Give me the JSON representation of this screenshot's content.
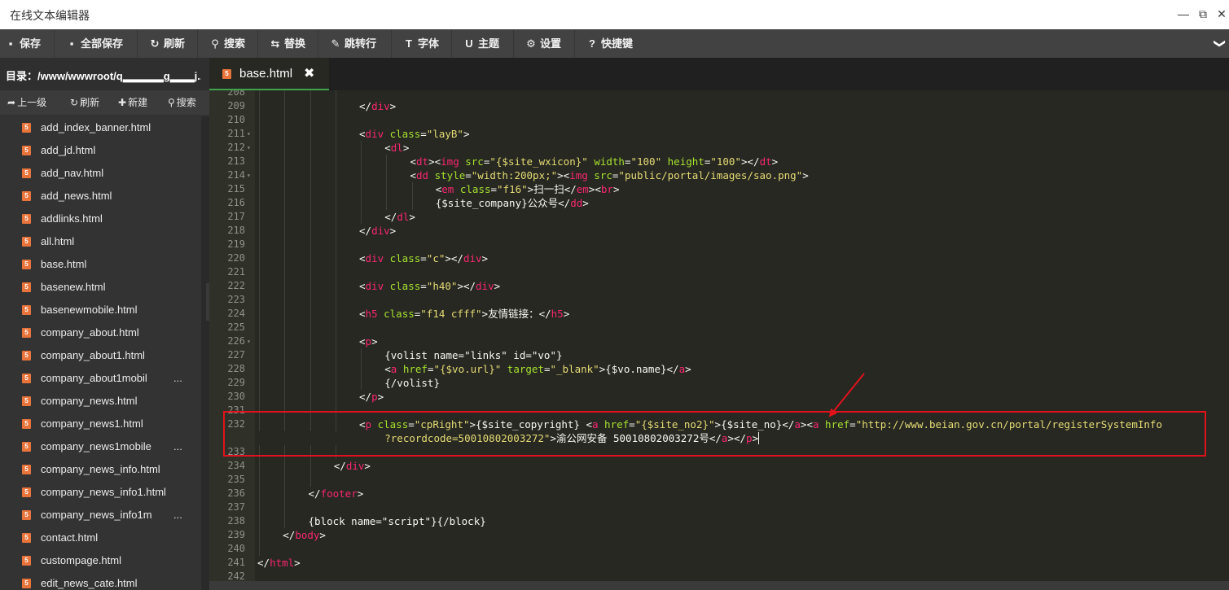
{
  "window": {
    "title": "在线文本编辑器",
    "controls": [
      "—",
      "⧉",
      "✕"
    ]
  },
  "toolbar": [
    {
      "label": "保存",
      "icon": "save-icon",
      "glyph": "▪"
    },
    {
      "label": "全部保存",
      "icon": "save-all-icon",
      "glyph": "▪"
    },
    {
      "label": "刷新",
      "icon": "refresh-icon",
      "glyph": "↻"
    },
    {
      "label": "搜索",
      "icon": "search-icon",
      "glyph": "⚲"
    },
    {
      "label": "替换",
      "icon": "replace-icon",
      "glyph": "⇆"
    },
    {
      "label": "跳转行",
      "icon": "pin-icon",
      "glyph": "✎"
    },
    {
      "label": "字体",
      "icon": "font-icon",
      "glyph": "T"
    },
    {
      "label": "主题",
      "icon": "theme-icon",
      "glyph": "U"
    },
    {
      "label": "设置",
      "icon": "gear-icon",
      "glyph": "⚙"
    },
    {
      "label": "快捷键",
      "icon": "help-icon",
      "glyph": "?"
    }
  ],
  "toolbar_more": "❯",
  "sidebar": {
    "directory": "目录：/www/wwwroot/q▂▂▂▂▂g▂▂▂j...",
    "tools": [
      {
        "label": "上一级",
        "icon": "up-level-icon",
        "glyph": "➦"
      },
      {
        "label": "刷新",
        "icon": "refresh-icon",
        "glyph": "↻"
      },
      {
        "label": "新建",
        "icon": "plus-icon",
        "glyph": "✚"
      },
      {
        "label": "搜索",
        "icon": "search-icon",
        "glyph": "⚲"
      }
    ],
    "files": [
      {
        "name": "add_index_banner.html"
      },
      {
        "name": "add_jd.html"
      },
      {
        "name": "add_nav.html"
      },
      {
        "name": "add_news.html"
      },
      {
        "name": "addlinks.html"
      },
      {
        "name": "all.html"
      },
      {
        "name": "base.html"
      },
      {
        "name": "basenew.html"
      },
      {
        "name": "basenewmobile.html"
      },
      {
        "name": "company_about.html"
      },
      {
        "name": "company_about1.html"
      },
      {
        "name": "company_about1mobil",
        "more": "..."
      },
      {
        "name": "company_news.html"
      },
      {
        "name": "company_news1.html"
      },
      {
        "name": "company_news1mobile",
        "more": "..."
      },
      {
        "name": "company_news_info.html"
      },
      {
        "name": "company_news_info1.html"
      },
      {
        "name": "company_news_info1m",
        "more": "..."
      },
      {
        "name": "contact.html"
      },
      {
        "name": "custompage.html"
      },
      {
        "name": "edit_news_cate.html"
      }
    ],
    "file_icon": "5"
  },
  "tab": {
    "label": "base.html",
    "close": "✖",
    "icon": "5"
  },
  "editor": {
    "lines": [
      {
        "n": "208",
        "indent": 4,
        "fold": false,
        "tokens": []
      },
      {
        "n": "209",
        "indent": 4,
        "fold": false,
        "tokens": [
          {
            "t": "</",
            "c": "tx"
          },
          {
            "t": "div",
            "c": "tg"
          },
          {
            "t": ">",
            "c": "tx"
          }
        ]
      },
      {
        "n": "210",
        "indent": 4,
        "fold": false,
        "tokens": []
      },
      {
        "n": "211",
        "indent": 4,
        "fold": true,
        "tokens": [
          {
            "t": "<",
            "c": "tx"
          },
          {
            "t": "div",
            "c": "tg"
          },
          {
            "t": " class",
            "c": "at"
          },
          {
            "t": "=",
            "c": "tx"
          },
          {
            "t": "\"layB\"",
            "c": "st"
          },
          {
            "t": ">",
            "c": "tx"
          }
        ]
      },
      {
        "n": "212",
        "indent": 5,
        "fold": true,
        "tokens": [
          {
            "t": "<",
            "c": "tx"
          },
          {
            "t": "dl",
            "c": "tg"
          },
          {
            "t": ">",
            "c": "tx"
          }
        ]
      },
      {
        "n": "213",
        "indent": 6,
        "fold": false,
        "tokens": [
          {
            "t": "<",
            "c": "tx"
          },
          {
            "t": "dt",
            "c": "tg"
          },
          {
            "t": "><",
            "c": "tx"
          },
          {
            "t": "img",
            "c": "tg"
          },
          {
            "t": " src",
            "c": "at"
          },
          {
            "t": "=",
            "c": "tx"
          },
          {
            "t": "\"{$site_wxicon}\"",
            "c": "st"
          },
          {
            "t": " width",
            "c": "at"
          },
          {
            "t": "=",
            "c": "tx"
          },
          {
            "t": "\"100\"",
            "c": "st"
          },
          {
            "t": " height",
            "c": "at"
          },
          {
            "t": "=",
            "c": "tx"
          },
          {
            "t": "\"100\"",
            "c": "st"
          },
          {
            "t": "></",
            "c": "tx"
          },
          {
            "t": "dt",
            "c": "tg"
          },
          {
            "t": ">",
            "c": "tx"
          }
        ]
      },
      {
        "n": "214",
        "indent": 6,
        "fold": true,
        "tokens": [
          {
            "t": "<",
            "c": "tx"
          },
          {
            "t": "dd",
            "c": "tg"
          },
          {
            "t": " style",
            "c": "at"
          },
          {
            "t": "=",
            "c": "tx"
          },
          {
            "t": "\"width:200px;\"",
            "c": "st"
          },
          {
            "t": "><",
            "c": "tx"
          },
          {
            "t": "img",
            "c": "tg"
          },
          {
            "t": " src",
            "c": "at"
          },
          {
            "t": "=",
            "c": "tx"
          },
          {
            "t": "\"public/portal/images/sao.png\"",
            "c": "st"
          },
          {
            "t": ">",
            "c": "tx"
          }
        ]
      },
      {
        "n": "215",
        "indent": 7,
        "fold": false,
        "tokens": [
          {
            "t": "<",
            "c": "tx"
          },
          {
            "t": "em",
            "c": "tg"
          },
          {
            "t": " class",
            "c": "at"
          },
          {
            "t": "=",
            "c": "tx"
          },
          {
            "t": "\"f16\"",
            "c": "st"
          },
          {
            "t": ">扫一扫</",
            "c": "tx"
          },
          {
            "t": "em",
            "c": "tg"
          },
          {
            "t": "><",
            "c": "tx"
          },
          {
            "t": "br",
            "c": "tg"
          },
          {
            "t": ">",
            "c": "tx"
          }
        ]
      },
      {
        "n": "216",
        "indent": 7,
        "fold": false,
        "tokens": [
          {
            "t": "{$site_company}公众号</",
            "c": "tx"
          },
          {
            "t": "dd",
            "c": "tg"
          },
          {
            "t": ">",
            "c": "tx"
          }
        ]
      },
      {
        "n": "217",
        "indent": 5,
        "fold": false,
        "tokens": [
          {
            "t": "</",
            "c": "tx"
          },
          {
            "t": "dl",
            "c": "tg"
          },
          {
            "t": ">",
            "c": "tx"
          }
        ]
      },
      {
        "n": "218",
        "indent": 4,
        "fold": false,
        "tokens": [
          {
            "t": "</",
            "c": "tx"
          },
          {
            "t": "div",
            "c": "tg"
          },
          {
            "t": ">",
            "c": "tx"
          }
        ]
      },
      {
        "n": "219",
        "indent": 4,
        "fold": false,
        "tokens": []
      },
      {
        "n": "220",
        "indent": 4,
        "fold": false,
        "tokens": [
          {
            "t": "<",
            "c": "tx"
          },
          {
            "t": "div",
            "c": "tg"
          },
          {
            "t": " class",
            "c": "at"
          },
          {
            "t": "=",
            "c": "tx"
          },
          {
            "t": "\"c\"",
            "c": "st"
          },
          {
            "t": "></",
            "c": "tx"
          },
          {
            "t": "div",
            "c": "tg"
          },
          {
            "t": ">",
            "c": "tx"
          }
        ]
      },
      {
        "n": "221",
        "indent": 4,
        "fold": false,
        "tokens": []
      },
      {
        "n": "222",
        "indent": 4,
        "fold": false,
        "tokens": [
          {
            "t": "<",
            "c": "tx"
          },
          {
            "t": "div",
            "c": "tg"
          },
          {
            "t": " class",
            "c": "at"
          },
          {
            "t": "=",
            "c": "tx"
          },
          {
            "t": "\"h40\"",
            "c": "st"
          },
          {
            "t": "></",
            "c": "tx"
          },
          {
            "t": "div",
            "c": "tg"
          },
          {
            "t": ">",
            "c": "tx"
          }
        ]
      },
      {
        "n": "223",
        "indent": 4,
        "fold": false,
        "tokens": []
      },
      {
        "n": "224",
        "indent": 4,
        "fold": false,
        "tokens": [
          {
            "t": "<",
            "c": "tx"
          },
          {
            "t": "h5",
            "c": "tg"
          },
          {
            "t": " class",
            "c": "at"
          },
          {
            "t": "=",
            "c": "tx"
          },
          {
            "t": "\"f14 cfff\"",
            "c": "st"
          },
          {
            "t": ">友情链接：</",
            "c": "tx"
          },
          {
            "t": "h5",
            "c": "tg"
          },
          {
            "t": ">",
            "c": "tx"
          }
        ]
      },
      {
        "n": "225",
        "indent": 4,
        "fold": false,
        "tokens": []
      },
      {
        "n": "226",
        "indent": 4,
        "fold": true,
        "tokens": [
          {
            "t": "<",
            "c": "tx"
          },
          {
            "t": "p",
            "c": "tg"
          },
          {
            "t": ">",
            "c": "tx"
          }
        ]
      },
      {
        "n": "227",
        "indent": 5,
        "fold": false,
        "tokens": [
          {
            "t": "{volist name=\"links\" id=\"vo\"}",
            "c": "tx"
          }
        ]
      },
      {
        "n": "228",
        "indent": 5,
        "fold": false,
        "tokens": [
          {
            "t": "<",
            "c": "tx"
          },
          {
            "t": "a",
            "c": "tg"
          },
          {
            "t": " href",
            "c": "at"
          },
          {
            "t": "=",
            "c": "tx"
          },
          {
            "t": "\"{$vo.url}\"",
            "c": "st"
          },
          {
            "t": " target",
            "c": "at"
          },
          {
            "t": "=",
            "c": "tx"
          },
          {
            "t": "\"_blank\"",
            "c": "st"
          },
          {
            "t": ">{$vo.name}</",
            "c": "tx"
          },
          {
            "t": "a",
            "c": "tg"
          },
          {
            "t": ">",
            "c": "tx"
          }
        ]
      },
      {
        "n": "229",
        "indent": 5,
        "fold": false,
        "tokens": [
          {
            "t": "{/volist}",
            "c": "tx"
          }
        ]
      },
      {
        "n": "230",
        "indent": 4,
        "fold": false,
        "tokens": [
          {
            "t": "</",
            "c": "tx"
          },
          {
            "t": "p",
            "c": "tg"
          },
          {
            "t": ">",
            "c": "tx"
          }
        ]
      },
      {
        "n": "231",
        "indent": 4,
        "fold": false,
        "tokens": []
      },
      {
        "n": "232",
        "indent": 4,
        "fold": false,
        "tokens": [
          {
            "t": "<",
            "c": "tx"
          },
          {
            "t": "p",
            "c": "tg"
          },
          {
            "t": " class",
            "c": "at"
          },
          {
            "t": "=",
            "c": "tx"
          },
          {
            "t": "\"cpRight\"",
            "c": "st"
          },
          {
            "t": ">{$site_copyright} <",
            "c": "tx"
          },
          {
            "t": "a",
            "c": "tg"
          },
          {
            "t": " href",
            "c": "at"
          },
          {
            "t": "=",
            "c": "tx"
          },
          {
            "t": "\"{$site_no2}\"",
            "c": "st"
          },
          {
            "t": ">{$site_no}</",
            "c": "tx"
          },
          {
            "t": "a",
            "c": "tg"
          },
          {
            "t": "><",
            "c": "tx"
          },
          {
            "t": "a",
            "c": "tg"
          },
          {
            "t": " href",
            "c": "at"
          },
          {
            "t": "=",
            "c": "tx"
          },
          {
            "t": "\"http://www.beian.gov.cn/portal/registerSystemInfo",
            "c": "st"
          }
        ],
        "wrap": [
          {
            "t": "?recordcode=50010802003272\"",
            "c": "st"
          },
          {
            "t": ">渝公网安备 50010802003272号</",
            "c": "tx"
          },
          {
            "t": "a",
            "c": "tg"
          },
          {
            "t": "></",
            "c": "tx"
          },
          {
            "t": "p",
            "c": "tg"
          },
          {
            "t": ">",
            "c": "tx"
          }
        ]
      },
      {
        "n": "233",
        "indent": 4,
        "fold": false,
        "tokens": []
      },
      {
        "n": "234",
        "indent": 3,
        "fold": false,
        "tokens": [
          {
            "t": "</",
            "c": "tx"
          },
          {
            "t": "div",
            "c": "tg"
          },
          {
            "t": ">",
            "c": "tx"
          }
        ]
      },
      {
        "n": "235",
        "indent": 3,
        "fold": false,
        "tokens": []
      },
      {
        "n": "236",
        "indent": 2,
        "fold": false,
        "tokens": [
          {
            "t": "</",
            "c": "tx"
          },
          {
            "t": "footer",
            "c": "tg"
          },
          {
            "t": ">",
            "c": "tx"
          }
        ]
      },
      {
        "n": "237",
        "indent": 2,
        "fold": false,
        "tokens": []
      },
      {
        "n": "238",
        "indent": 2,
        "fold": false,
        "tokens": [
          {
            "t": "{block name=\"script\"}{/block}",
            "c": "tx"
          }
        ]
      },
      {
        "n": "239",
        "indent": 1,
        "fold": false,
        "tokens": [
          {
            "t": "</",
            "c": "tx"
          },
          {
            "t": "body",
            "c": "tg"
          },
          {
            "t": ">",
            "c": "tx"
          }
        ]
      },
      {
        "n": "240",
        "indent": 1,
        "fold": false,
        "tokens": []
      },
      {
        "n": "241",
        "indent": 0,
        "fold": false,
        "tokens": [
          {
            "t": "</",
            "c": "tx"
          },
          {
            "t": "html",
            "c": "tg"
          },
          {
            "t": ">",
            "c": "tx"
          }
        ]
      },
      {
        "n": "242",
        "indent": 0,
        "fold": false,
        "tokens": []
      }
    ]
  },
  "colors": {
    "tag": "#f92672",
    "attr": "#a6e22e",
    "string": "#e6db74",
    "text": "#f8f8f2",
    "active_tab_underline": "#3fa34d",
    "annotation": "#e0121b",
    "file_icon": "#e8743b"
  }
}
